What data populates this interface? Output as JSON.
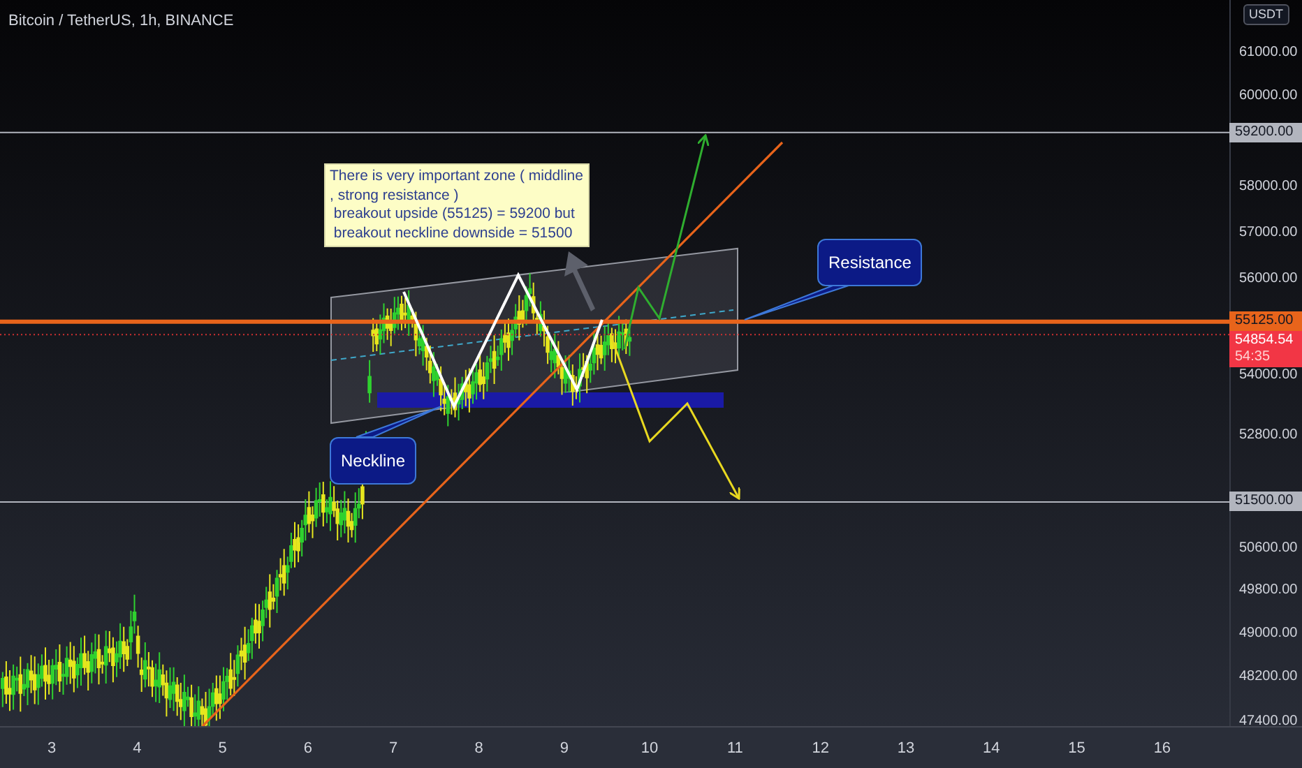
{
  "header": {
    "title": "Bitcoin / TetherUS, 1h, BINANCE"
  },
  "price_axis": {
    "currency": "USDT",
    "labels": [
      "61000.00",
      "60000.00",
      "58000.00",
      "57000.00",
      "56000.00",
      "54000.00",
      "52800.00",
      "50600.00",
      "49800.00",
      "49000.00",
      "48200.00",
      "47400.00"
    ]
  },
  "price_tags": [
    {
      "kind": "level",
      "text": "59200.00",
      "color": "#b2b5be"
    },
    {
      "kind": "level",
      "text": "55125.00",
      "color": "#e8641b"
    },
    {
      "kind": "last",
      "text": "54854.54",
      "countdown": "54:35",
      "color": "#f23645"
    },
    {
      "kind": "level",
      "text": "51500.00",
      "color": "#b2b5be"
    }
  ],
  "time_axis": {
    "labels": [
      "3",
      "4",
      "5",
      "6",
      "7",
      "8",
      "9",
      "10",
      "11",
      "12",
      "13",
      "14",
      "15",
      "16"
    ]
  },
  "annotations": [
    {
      "kind": "note",
      "text": "There is very important zone ( middline\n, strong resistance )\n breakout upside (55125) = 59200 but\n breakout neckline downside = 51500"
    },
    {
      "kind": "callout",
      "text": "Resistance"
    },
    {
      "kind": "callout",
      "text": "Neckline"
    }
  ]
}
